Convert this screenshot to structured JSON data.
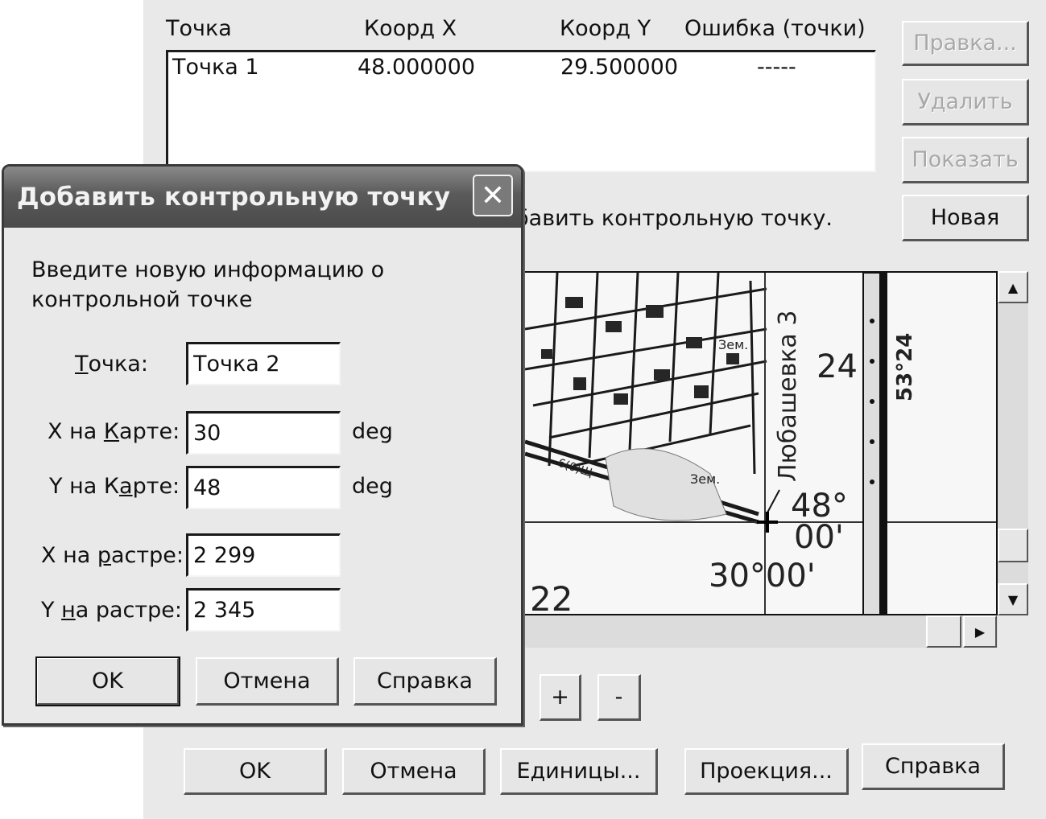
{
  "main": {
    "columns": [
      "Точка",
      "Коорд X",
      "Коорд Y",
      "Ошибка (точки)"
    ],
    "rows": [
      {
        "point": "Точка 1",
        "x": "48.000000",
        "y": "29.500000",
        "error": "-----"
      }
    ],
    "side_buttons": {
      "edit": "Правка...",
      "delete": "Удалить",
      "show": "Показать",
      "new": "Новая"
    },
    "hint": "бавить контрольную точку.",
    "zoom": {
      "plus": "+",
      "minus": "-"
    },
    "bottom_buttons": {
      "ok": "OK",
      "cancel": "Отмена",
      "units": "Единицы...",
      "projection": "Проекция...",
      "help": "Справка"
    },
    "map": {
      "label_street": "Любашевка 3",
      "label_24": "24",
      "label_coord_vertical": "53°24",
      "label_48": "48°",
      "label_00a": "00'",
      "label_30": "30°00'",
      "label_22": "22",
      "label_zem1": "Зем.",
      "label_zem2": "Зем.",
      "label_small": "6(0)Щ"
    }
  },
  "dialog": {
    "title": "Добавить контрольную точку",
    "close": "✕",
    "description": "Введите новую информацию о контрольной точке",
    "fields": {
      "point_label_rest": "очка:",
      "point_label_u": "Т",
      "point_value": "Точка 2",
      "mapx_label_pre": "X на ",
      "mapx_label_u": "К",
      "mapx_label_post": "арте:",
      "mapx_value": "30",
      "mapy_label_pre": "Y на К",
      "mapy_label_u": "а",
      "mapy_label_post": "рте:",
      "mapy_value": "48",
      "unit": "deg",
      "rasterx_label_pre": "X на ",
      "rasterx_label_u": "р",
      "rasterx_label_post": "астре:",
      "rasterx_value": "2 299",
      "rastery_label_pre": "Y ",
      "rastery_label_u": "н",
      "rastery_label_post": "а растре:",
      "rastery_value": "2 345"
    },
    "buttons": {
      "ok": "OK",
      "cancel": "Отмена",
      "help": "Справка"
    }
  }
}
